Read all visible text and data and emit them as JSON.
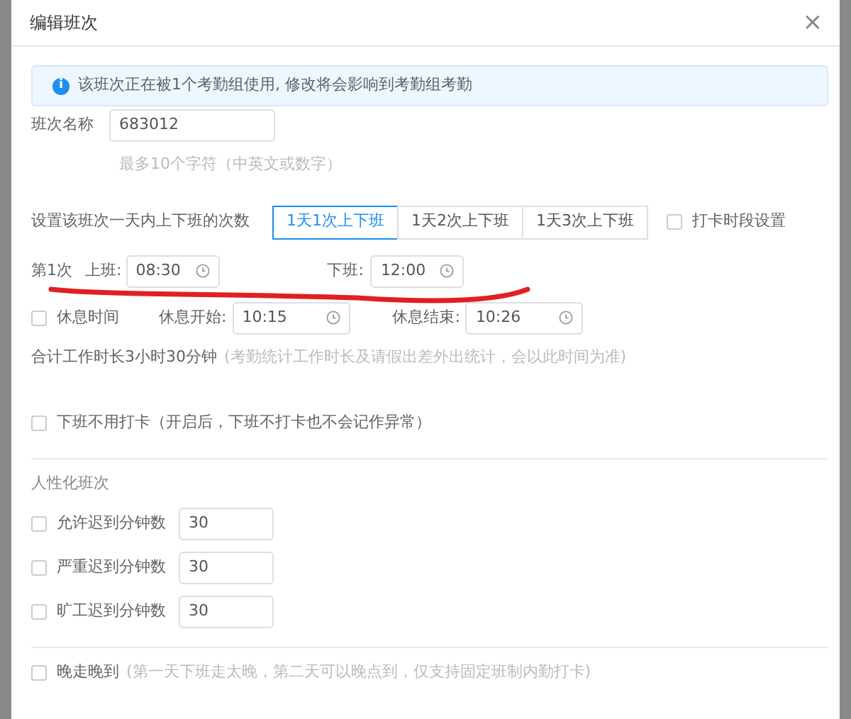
{
  "dialog": {
    "title": "编辑班次",
    "close": "×"
  },
  "alert": {
    "icon": "i",
    "text": "该班次正在被1个考勤组使用, 修改将会影响到考勤组考勤"
  },
  "name_field": {
    "label": "班次名称",
    "value": "683012",
    "hint": "最多10个字符（中英文或数字）"
  },
  "times_per_day": {
    "label": "设置该班次一天内上下班的次数",
    "options": [
      {
        "label": "1天1次上下班",
        "selected": true
      },
      {
        "label": "1天2次上下班",
        "selected": false
      },
      {
        "label": "1天3次上下班",
        "selected": false
      }
    ],
    "punch_setting": {
      "label": "打卡时段设置",
      "checked": false
    }
  },
  "shift": {
    "label": "第1次",
    "on_label": "上班:",
    "on_time": "08:30",
    "off_label": "下班:",
    "off_time": "12:00"
  },
  "rest": {
    "label": "休息时间",
    "checked": false,
    "start_label": "休息开始:",
    "start": "10:15",
    "end_label": "休息结束:",
    "end": "10:26"
  },
  "total": {
    "text": "合计工作时长3小时30分钟",
    "note": "(考勤统计工作时长及请假出差外出统计，会以此时间为准)"
  },
  "no_punch_off": {
    "label": "下班不用打卡（开启后，下班不打卡也不会记作异常）",
    "checked": false
  },
  "humanized": {
    "title": "人性化班次",
    "rows": [
      {
        "label": "允许迟到分钟数",
        "checked": false,
        "value": "30"
      },
      {
        "label": "严重迟到分钟数",
        "checked": false,
        "value": "30"
      },
      {
        "label": "旷工迟到分钟数",
        "checked": false,
        "value": "30"
      }
    ]
  },
  "late_leave": {
    "label": "晚走晚到",
    "note": "(第一天下班走太晚，第二天可以晚点到，仅支持固定班制内勤打卡)",
    "checked": false
  }
}
